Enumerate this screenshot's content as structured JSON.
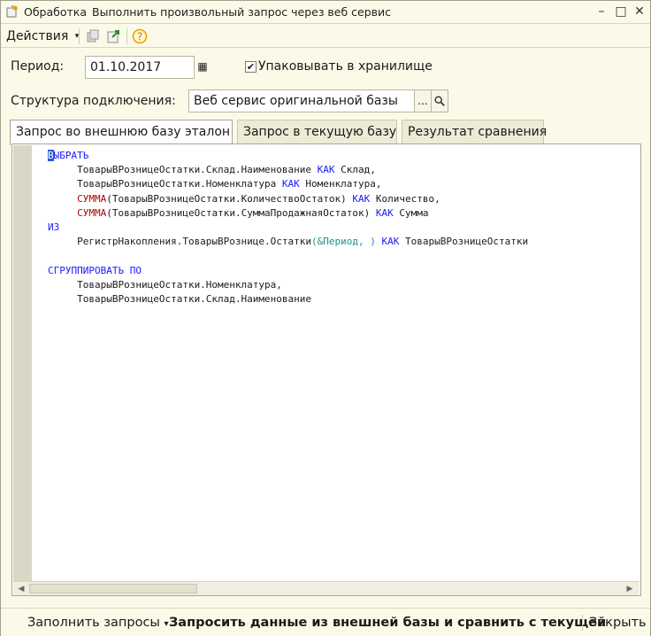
{
  "window": {
    "app_label": "Обработка",
    "title": "Выполнить произвольный запрос через веб сервис",
    "minimize_glyph": "–",
    "maximize_glyph": "□",
    "close_glyph": "✕"
  },
  "toolbar": {
    "actions_label": "Действия",
    "actions_arrow": "▾",
    "icons": [
      "copy-icon",
      "export-icon",
      "help-icon"
    ]
  },
  "form": {
    "period_label": "Период:",
    "period_value": "01.10.2017",
    "calendar_glyph": "▦",
    "pack_checkbox_label": "Упаковывать в хранилище",
    "pack_checked": true,
    "check_glyph": "✔",
    "structure_label": "Структура подключения:",
    "structure_value": "Веб сервис оригинальной базы",
    "select_button_glyph": "...",
    "search_glyph": "🔍"
  },
  "tabs": [
    {
      "label": "Запрос во внешнюю базу эталон",
      "active": true
    },
    {
      "label": "Запрос в текущую базу",
      "active": false
    },
    {
      "label": "Результат сравнения",
      "active": false
    }
  ],
  "editor": {
    "lines": [
      [
        {
          "t": "В",
          "c": "cursor"
        },
        {
          "t": "ЫБРАТЬ",
          "c": "kw"
        }
      ],
      [
        {
          "t": "\tТоварыВРозницеОстатки.Склад.Наименование ",
          "c": ""
        },
        {
          "t": "КАК",
          "c": "kw"
        },
        {
          "t": " Склад,",
          "c": ""
        }
      ],
      [
        {
          "t": "\tТоварыВРозницеОстатки.Номенклатура ",
          "c": ""
        },
        {
          "t": "КАК",
          "c": "kw"
        },
        {
          "t": " Номенклатура,",
          "c": ""
        }
      ],
      [
        {
          "t": "\t",
          "c": ""
        },
        {
          "t": "СУММА",
          "c": "fn"
        },
        {
          "t": "(ТоварыВРозницеОстатки.КоличествоОстаток) ",
          "c": ""
        },
        {
          "t": "КАК",
          "c": "kw"
        },
        {
          "t": " Количество,",
          "c": ""
        }
      ],
      [
        {
          "t": "\t",
          "c": ""
        },
        {
          "t": "СУММА",
          "c": "fn"
        },
        {
          "t": "(ТоварыВРозницеОстатки.СуммаПродажнаяОстаток) ",
          "c": ""
        },
        {
          "t": "КАК",
          "c": "kw"
        },
        {
          "t": " Сумма",
          "c": ""
        }
      ],
      [
        {
          "t": "ИЗ",
          "c": "kw"
        }
      ],
      [
        {
          "t": "\tРегистрНакопления.ТоварыВРознице.Остатки",
          "c": ""
        },
        {
          "t": "(&Период, )",
          "c": "pr"
        },
        {
          "t": " ",
          "c": ""
        },
        {
          "t": "КАК",
          "c": "kw"
        },
        {
          "t": " ТоварыВРозницеОстатки",
          "c": ""
        }
      ],
      [
        {
          "t": "",
          "c": ""
        }
      ],
      [
        {
          "t": "СГРУППИРОВАТЬ ПО",
          "c": "kw"
        }
      ],
      [
        {
          "t": "\tТоварыВРозницеОстатки.Номенклатура,",
          "c": ""
        }
      ],
      [
        {
          "t": "\tТоварыВРозницеОстатки.Склад.Наименование",
          "c": ""
        }
      ]
    ],
    "scroll_left_glyph": "◀",
    "scroll_right_glyph": "▶"
  },
  "bottom": {
    "fill_queries_label": "Заполнить запросы",
    "fill_arrow": "▾",
    "request_compare_label": "Запросить данные из внешней базы и сравнить с текущей",
    "close_label": "Закрыть"
  },
  "colors": {
    "background": "#fbfae8",
    "keyword": "#1a1aff",
    "function": "#b00000",
    "parameter": "#1a8f8f",
    "help_icon": "#e8a400"
  }
}
